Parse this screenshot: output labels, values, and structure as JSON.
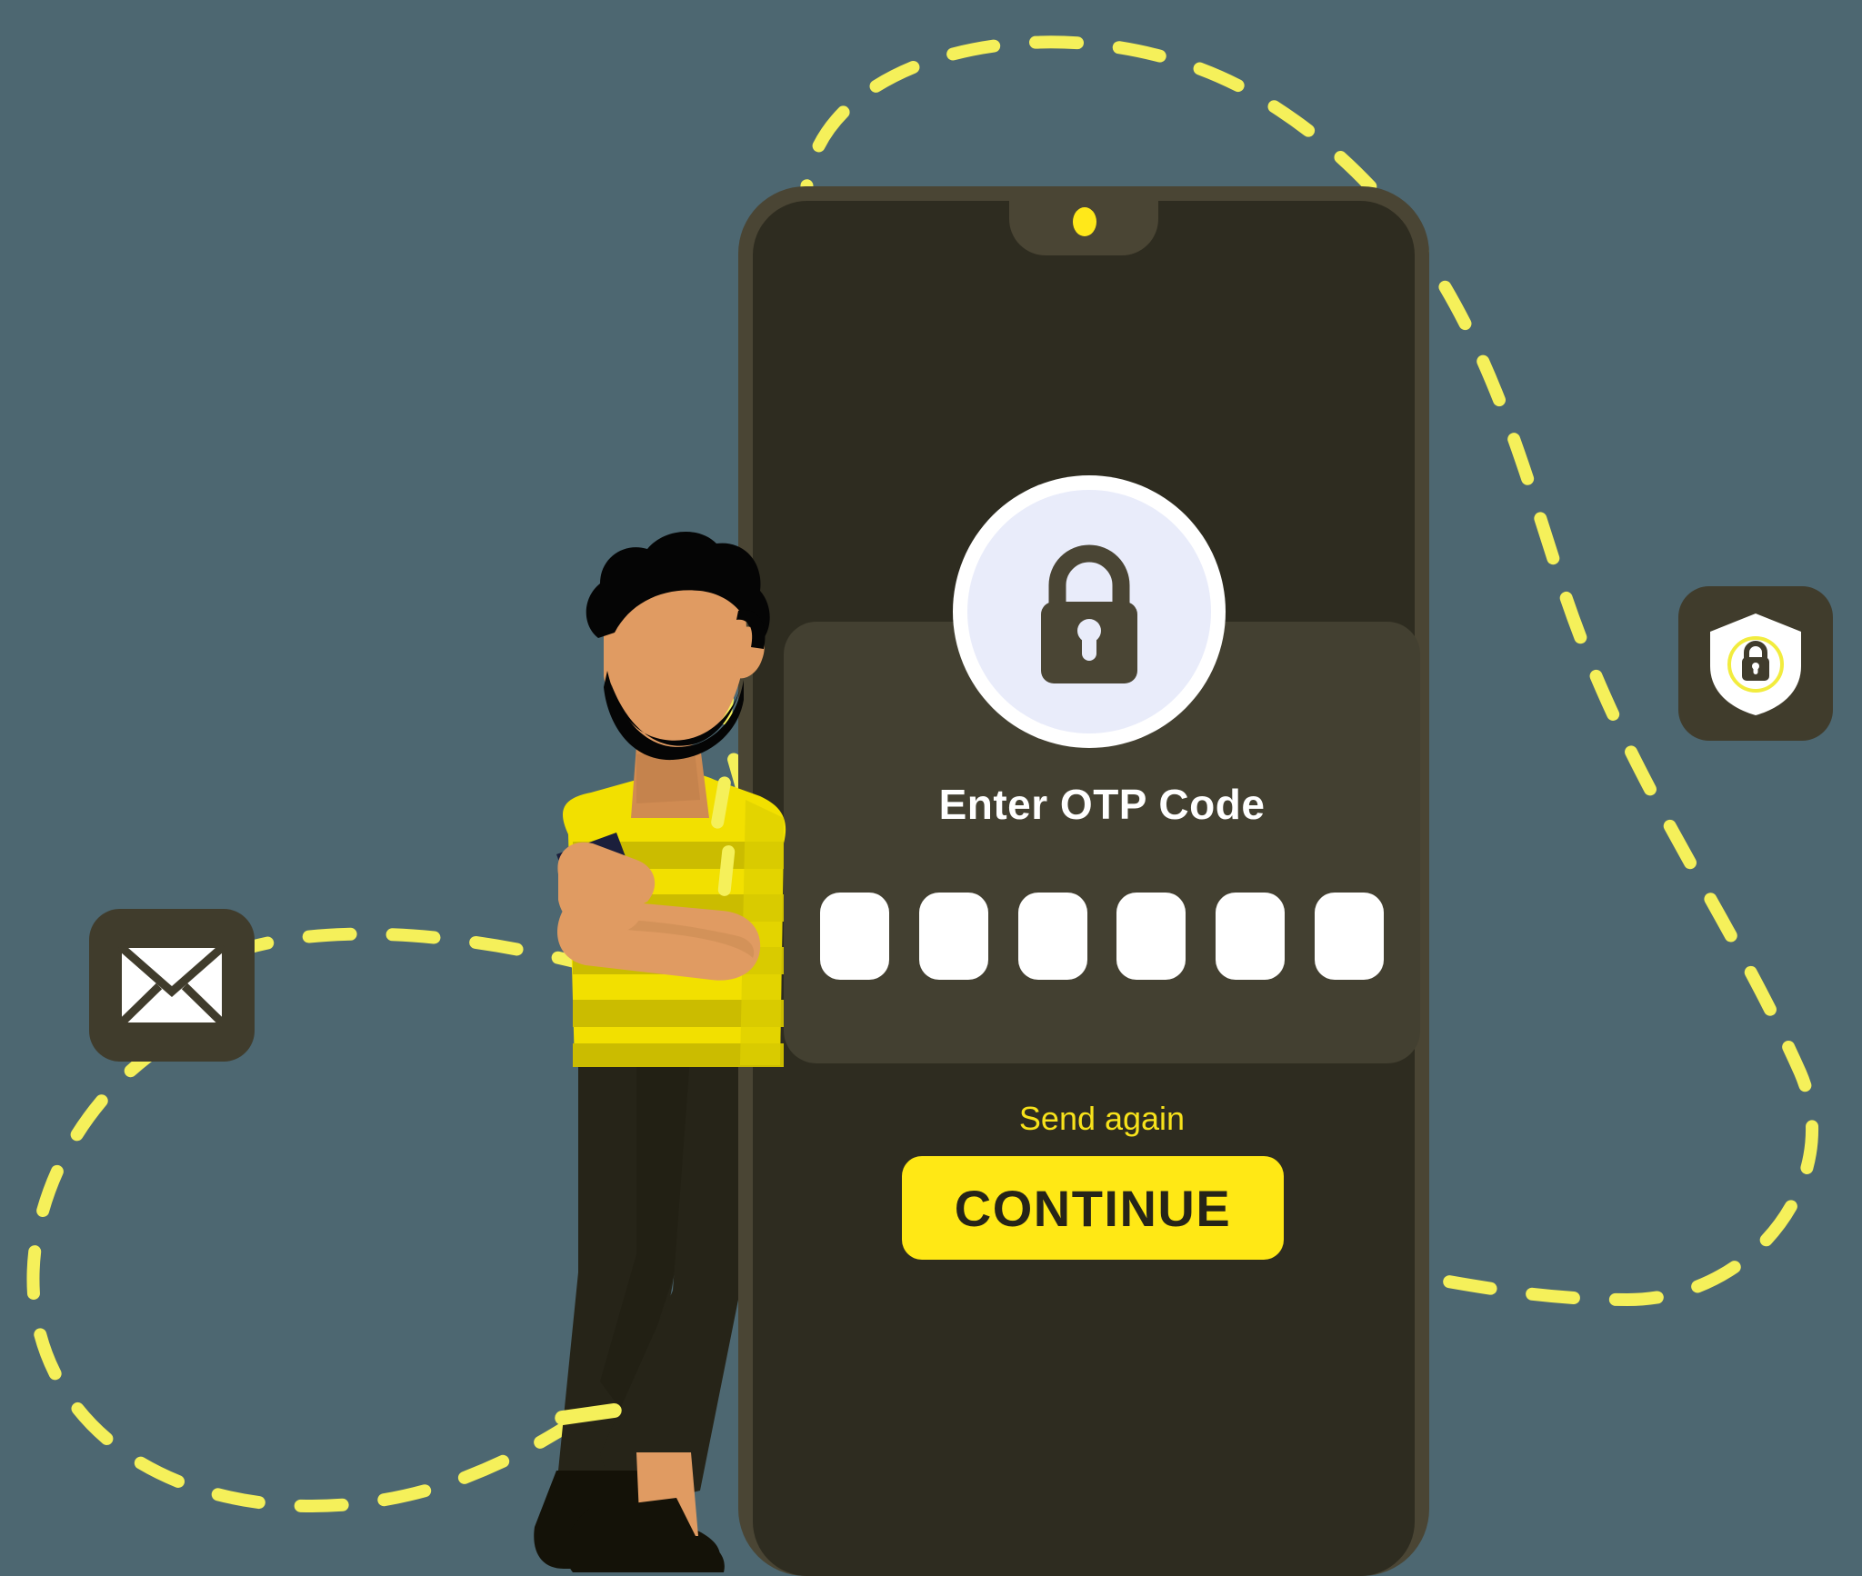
{
  "scene": {
    "title": "OTP verification illustration",
    "background_color": "#4d6771"
  },
  "colors": {
    "background": "#4d6771",
    "phone_frame": "#4a4534",
    "phone_screen": "#2e2c20",
    "card": "#434031",
    "accent_yellow": "#ffe815",
    "dash_yellow": "#f5f05a",
    "link_yellow": "#f7e21b",
    "badge_tile": "#403c2c",
    "lock_circle": "#e9ecfa",
    "lock_glyph": "#4a4534",
    "otp_box": "#ffffff",
    "shirt_yellow": "#f2e000",
    "shirt_stripe": "#cbbc00",
    "skin": "#e09b62",
    "hair": "#050505",
    "trousers": "#262418",
    "shoe": "#141208",
    "handheld_phone": "#1b1f3b"
  },
  "phone": {
    "camera_dot_name": "front-camera",
    "camera_dot_color": "#ffe81a"
  },
  "otp": {
    "title": "Enter OTP Code",
    "lock_icon": "padlock-icon",
    "digit_count": 6,
    "digits": [
      "",
      "",
      "",
      "",
      "",
      ""
    ],
    "placeholder": "",
    "resend_label": "Send again",
    "continue_label": "CONTINUE"
  },
  "badges": [
    {
      "id": "mail",
      "icon": "envelope-icon",
      "label": "Email",
      "tile_color": "#403c2c",
      "glyph_color": "#ffffff"
    },
    {
      "id": "shield",
      "icon": "shield-lock-icon",
      "label": "Secure",
      "tile_color": "#403c2c",
      "glyph_color": "#ffffff",
      "ring_color": "#f2ec3e"
    }
  ],
  "character": {
    "name": "person-with-phone",
    "description": "Man leaning against phone holding a smartphone",
    "shirt": "yellow striped t-shirt",
    "trousers": "dark olive trousers",
    "shoes": "dark sneakers"
  },
  "decoration": {
    "dashed_path_name": "dashed-connector-path",
    "dash_color": "#f5f05a",
    "dash_width": 14,
    "dash_pattern": "46 46"
  }
}
